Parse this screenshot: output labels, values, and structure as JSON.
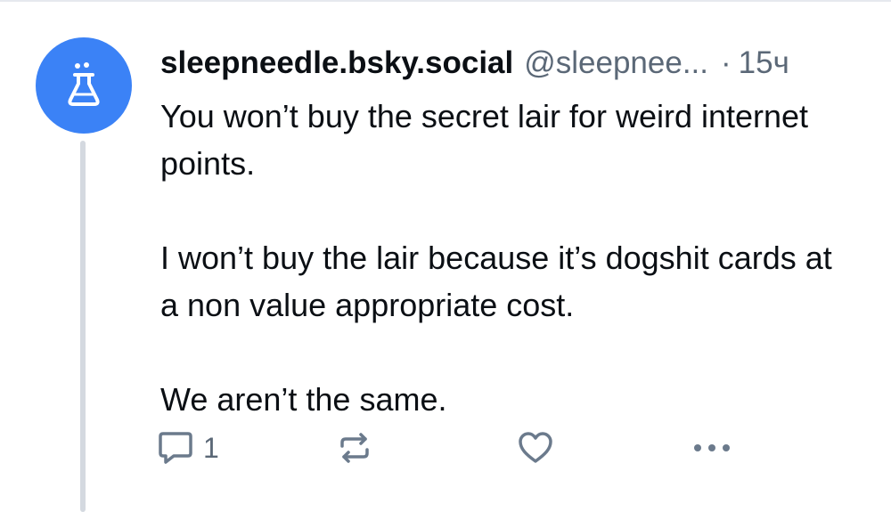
{
  "post": {
    "author_display_name": "sleepneedle.bsky.social",
    "author_handle": "@sleepnee...",
    "separator": "·",
    "timestamp": "15ч",
    "paragraphs": [
      "You won’t buy the secret lair for weird internet points.",
      "I won’t buy the lair because it’s dogshit cards at a non value appropriate cost.",
      "We aren’t the same."
    ],
    "reply_count": "1"
  },
  "icons": {
    "avatar": "flask-icon",
    "reply": "speech-bubble-icon",
    "repost": "repost-arrows-icon",
    "like": "heart-icon",
    "more": "ellipsis-icon"
  },
  "colors": {
    "avatar_bg": "#3b82f6",
    "thread_line": "#d4d9e0",
    "icon_gray": "#6b7a8c",
    "secondary_text": "#5b6877"
  }
}
